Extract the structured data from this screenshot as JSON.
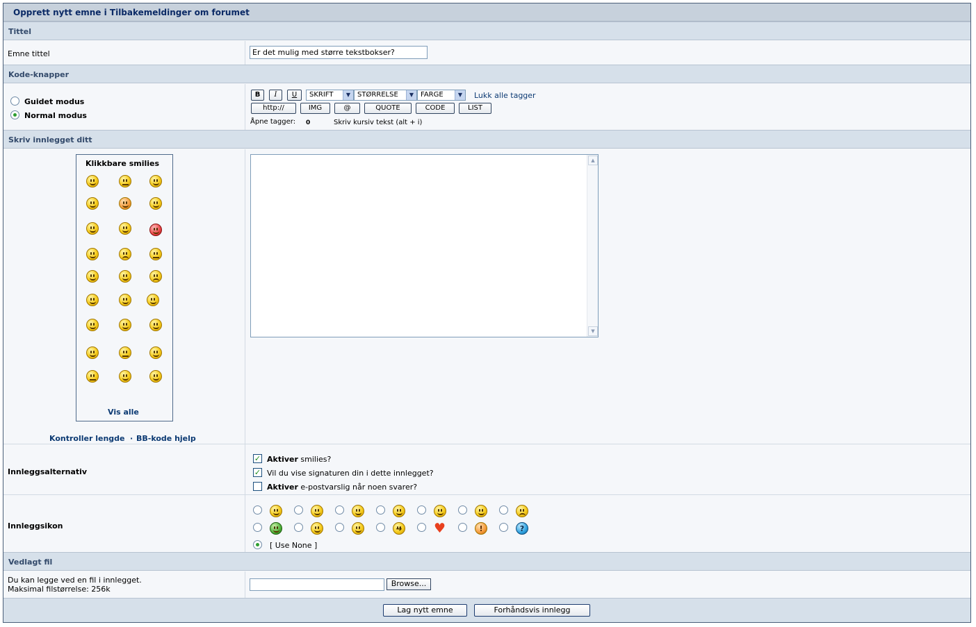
{
  "page_title": "Opprett nytt emne i Tilbakemeldinger om forumet",
  "sections": {
    "title": "Tittel",
    "code_buttons": "Kode-knapper",
    "write_post": "Skriv innlegget ditt",
    "attachment": "Vedlagt fil"
  },
  "subject": {
    "label": "Emne tittel",
    "value": "Er det mulig med større tekstbokser?"
  },
  "modes": {
    "guided": "Guidet modus",
    "normal": "Normal modus",
    "selected": "normal"
  },
  "toolbar": {
    "bold": "B",
    "italic": "I",
    "underline": "U",
    "font_select": "SKRIFT",
    "size_select": "STØRRELSE",
    "color_select": "FARGE",
    "close_all_tags": "Lukk alle tagger",
    "http": "http://",
    "img": "IMG",
    "email": "@",
    "quote": "QUOTE",
    "code": "CODE",
    "list": "LIST",
    "open_tags_label": "Åpne tagger:",
    "open_tags_count": "0",
    "hint": "Skriv kursiv tekst (alt + i)"
  },
  "smilies": {
    "title": "Klikkbare smilies",
    "show_all": "Vis alle",
    "check_length": "Kontroller lengde",
    "separator": "·",
    "bbcode_help": "BB-kode hjelp"
  },
  "post_options": {
    "label": "Innleggsalternativ",
    "enable_smilies_bold": "Aktiver",
    "enable_smilies_rest": " smilies?",
    "enable_smilies_checked": true,
    "show_signature": "Vil du vise signaturen din i dette innlegget?",
    "show_signature_checked": true,
    "notify_bold": "Aktiver",
    "notify_rest": " e-postvarslig når noen svarer?",
    "notify_checked": false
  },
  "post_icons": {
    "label": "Innleggsikon",
    "use_none": "[ Use None ]",
    "row1": [
      "smile-icon",
      "wink-icon",
      "cool-squint-icon",
      "grin-icon",
      "surprised-icon",
      "big-grin-icon",
      "angry-icon"
    ],
    "row2": [
      "green-sick-icon",
      "tongue-icon",
      "sunglasses-icon",
      "arrow-right-icon",
      "heart-icon",
      "exclamation-icon",
      "question-icon"
    ]
  },
  "attachment": {
    "desc_line1": "Du kan legge ved en fil i innlegget.",
    "desc_line2": "Maksimal filstørrelse: 256k",
    "browse": "Browse..."
  },
  "actions": {
    "submit": "Lag nytt emne",
    "preview": "Forhåndsvis innlegg"
  }
}
